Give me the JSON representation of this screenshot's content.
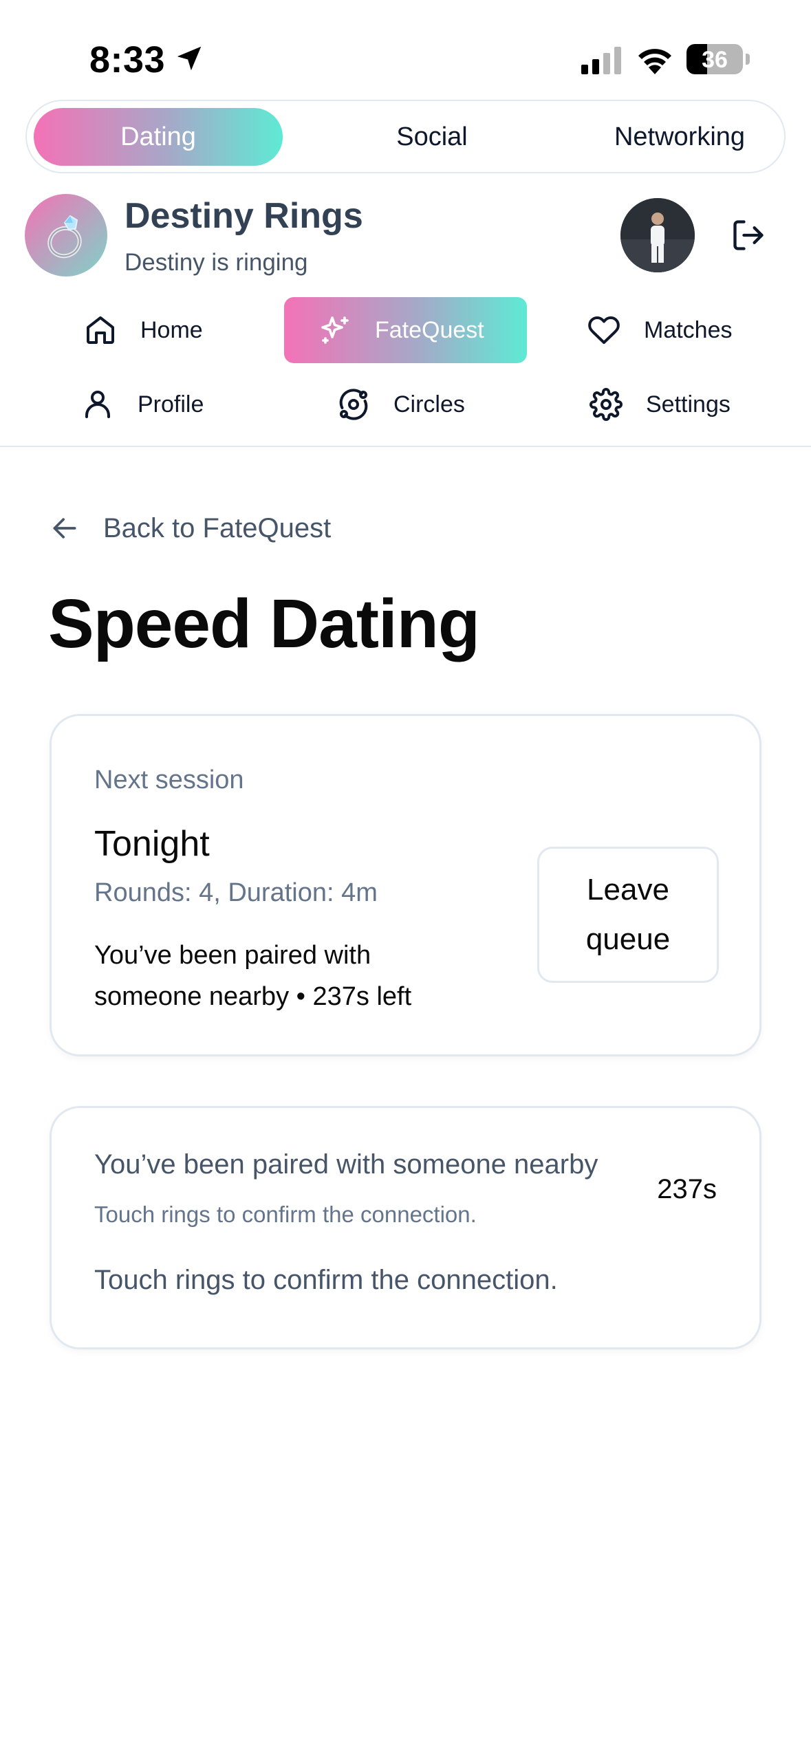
{
  "status_bar": {
    "time": "8:33",
    "battery": "36",
    "battery_level": 0.36
  },
  "mode_switch": {
    "items": [
      "Dating",
      "Social",
      "Networking"
    ],
    "active": "Dating"
  },
  "brand": {
    "title": "Destiny Rings",
    "subtitle": "Destiny is ringing"
  },
  "nav": {
    "home": "Home",
    "fatequest": "FateQuest",
    "matches": "Matches",
    "profile": "Profile",
    "circles": "Circles",
    "settings": "Settings",
    "active": "FateQuest"
  },
  "main": {
    "back_label": "Back to FateQuest",
    "title": "Speed Dating",
    "session_card": {
      "label": "Next session",
      "title": "Tonight",
      "meta": "Rounds: 4, Duration: 4m",
      "status": "You’ve been paired with someone nearby • 237s left",
      "leave_button": "Leave queue"
    },
    "pair_card": {
      "heading": "You’ve been paired with someone nearby",
      "timer": "237s",
      "subtext": "Touch rings to confirm the connection.",
      "note": "Touch rings to confirm the connection."
    }
  },
  "colors": {
    "gradient_start": "#f472b6",
    "gradient_end": "#5eead4",
    "muted_text": "#64748b",
    "border": "#e2e8f0"
  }
}
